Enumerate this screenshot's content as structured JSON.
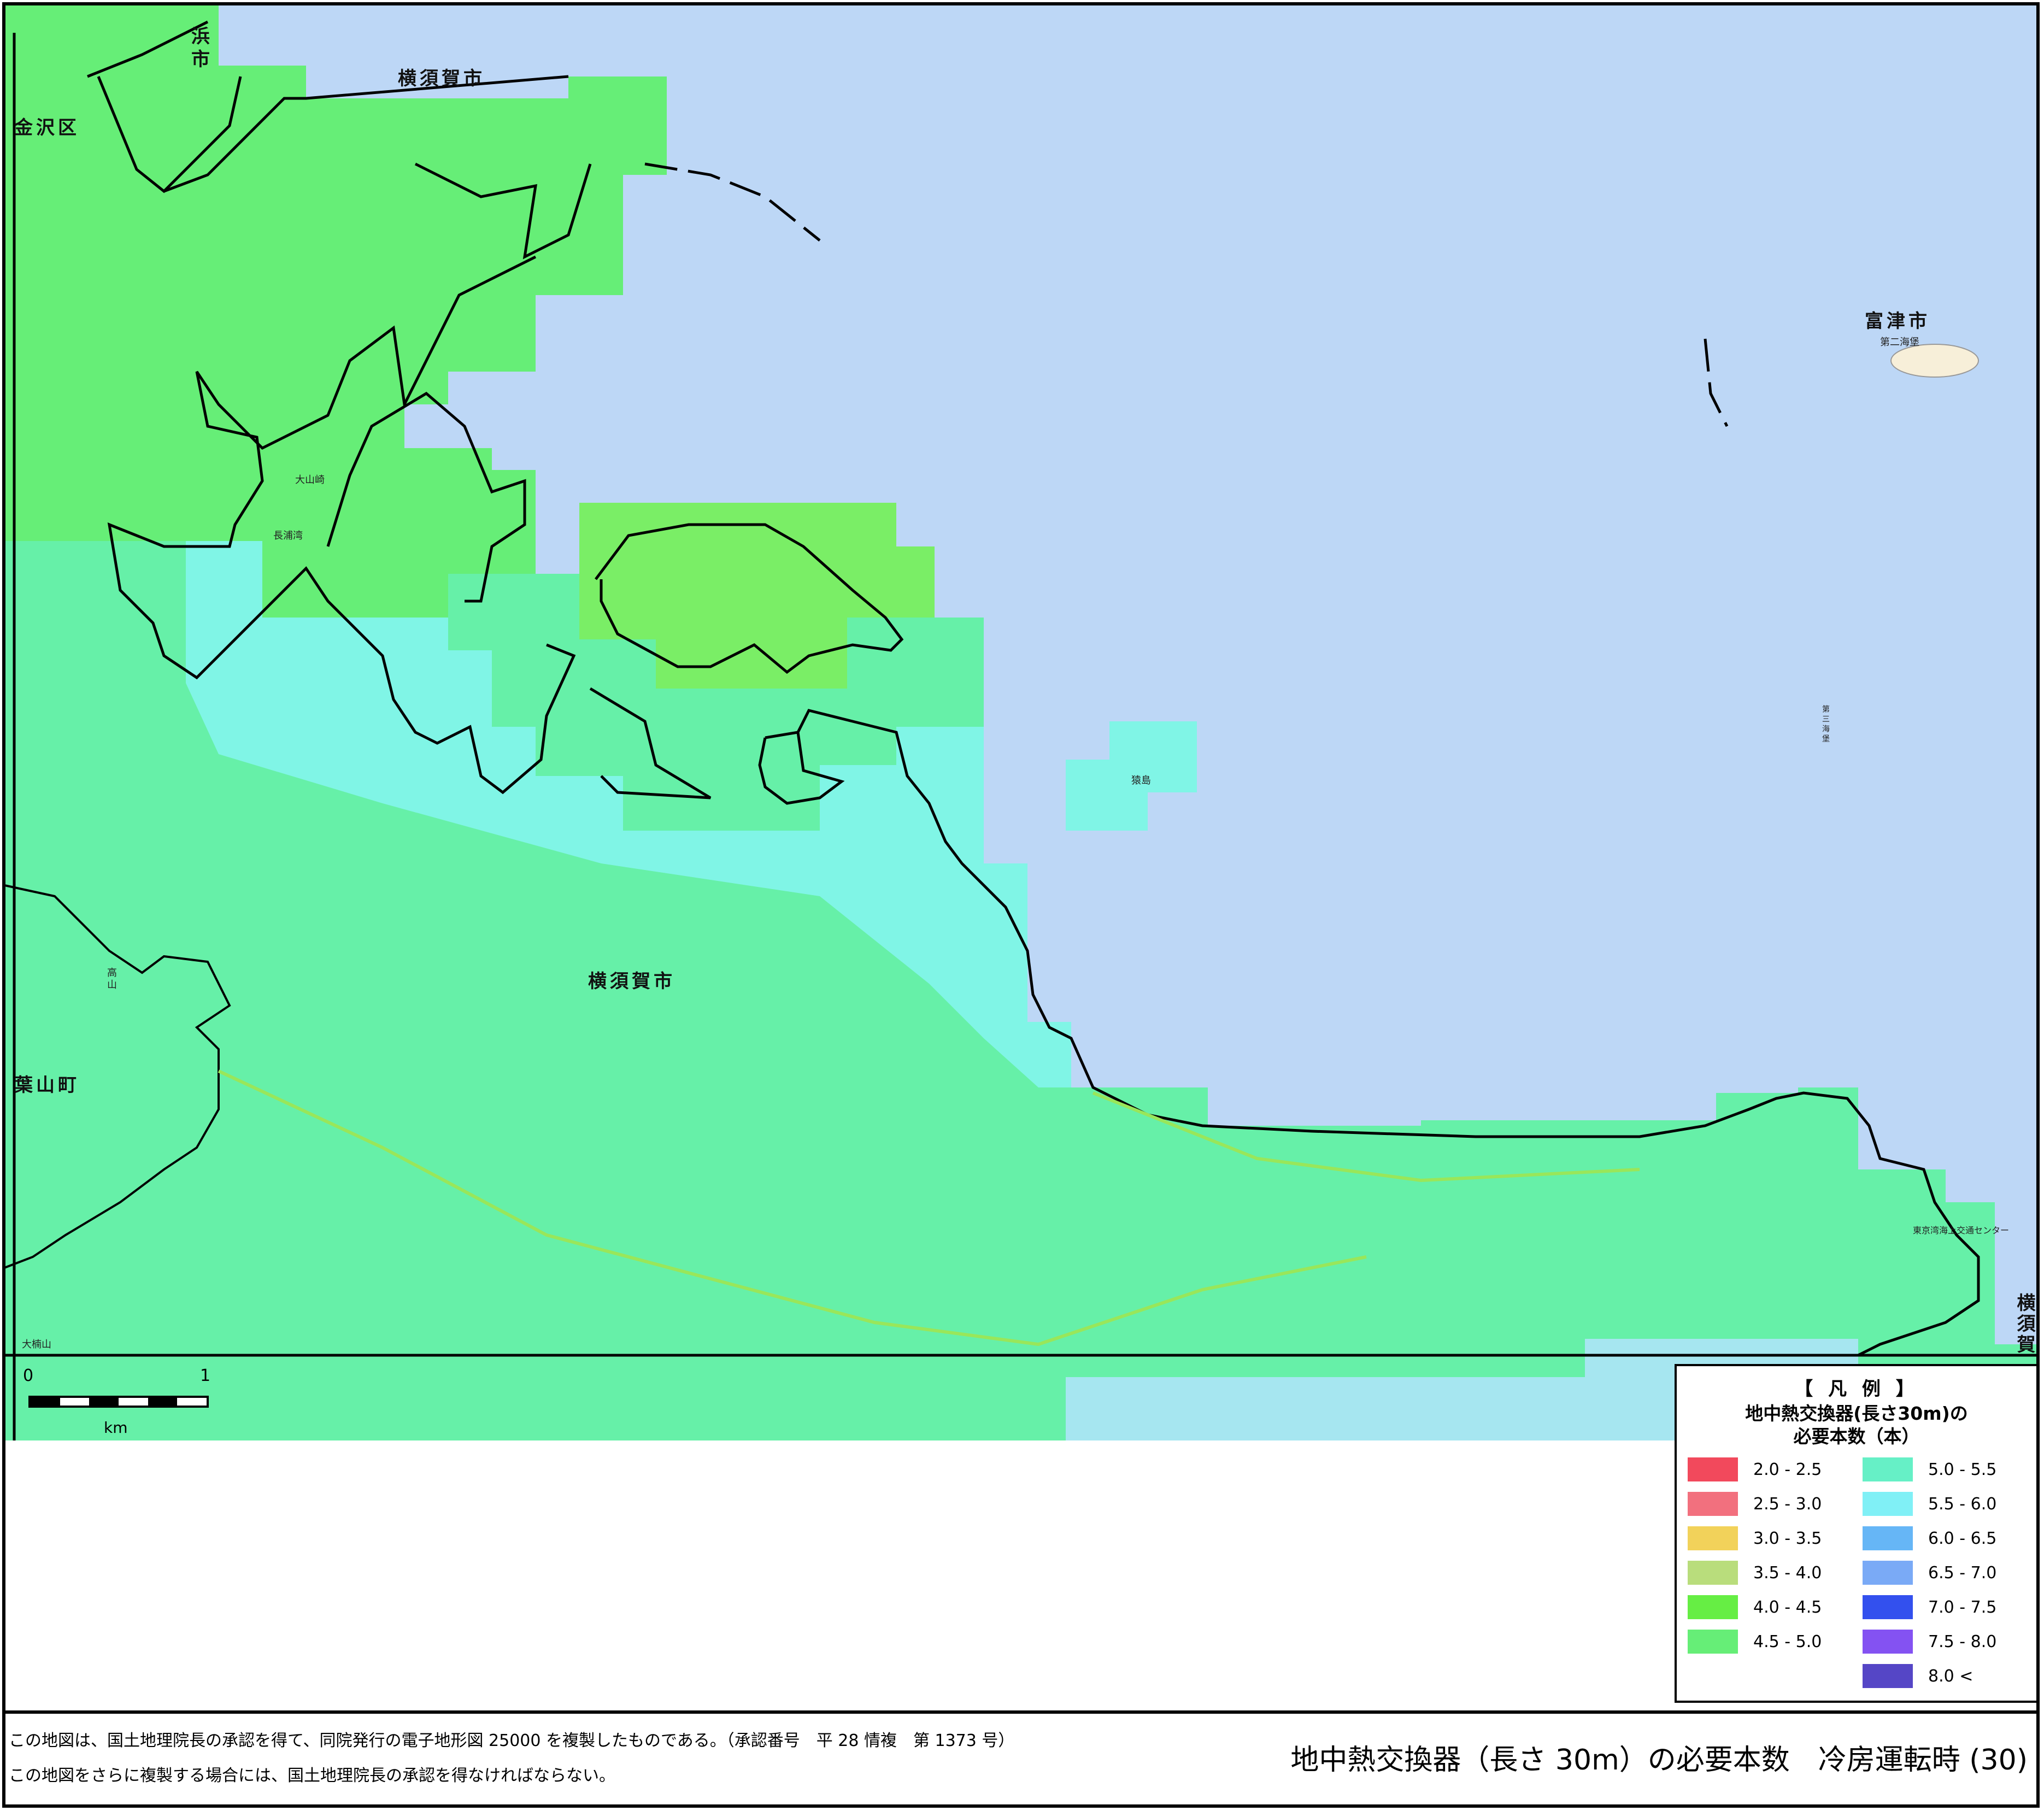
{
  "map": {
    "labels": {
      "yokohama": "浜市",
      "kanazawa": "金沢区",
      "yokosuka_north": "横須賀市",
      "yokosuka_center": "横須賀市",
      "hayama": "葉山町",
      "futtsu": "富津市",
      "yokosuka_east": "横須賀"
    },
    "small_labels": {
      "oyamazaki": "大山崎",
      "nagaura": "長浦湾",
      "otsuyama": "大楠山",
      "sarushima": "猿島",
      "daini_kaiho": "第二海堡",
      "daisan_kaiho": "第三海堡",
      "kaijo": "東京湾海上交通センター",
      "takashi": "高山"
    },
    "colors": {
      "sea": "#bdd7f6",
      "land_green": "#66ee66",
      "land_seafoam": "#66f0a8",
      "land_cyan": "#80f5e6",
      "land_lightblue": "#a6e6f0"
    }
  },
  "scale": {
    "tick_0": "0",
    "tick_1": "1",
    "unit": "km"
  },
  "legend": {
    "title": "【 凡 例 】",
    "subtitle_line1": "地中熱交換器(長さ30m)の",
    "subtitle_line2": "必要本数（本）",
    "items": [
      {
        "label": "2.0 - 2.5",
        "color": "#f2495c"
      },
      {
        "label": "2.5 - 3.0",
        "color": "#f2707e"
      },
      {
        "label": "3.0 - 3.5",
        "color": "#f2d25a"
      },
      {
        "label": "3.5 - 4.0",
        "color": "#b9dd7c"
      },
      {
        "label": "4.0 - 4.5",
        "color": "#66ee44"
      },
      {
        "label": "4.5 - 5.0",
        "color": "#66ee77"
      },
      {
        "label": "5.0 - 5.5",
        "color": "#66f0c6"
      },
      {
        "label": "5.5 - 6.0",
        "color": "#80f0f6"
      },
      {
        "label": "6.0 - 6.5",
        "color": "#66b6f6"
      },
      {
        "label": "6.5 - 7.0",
        "color": "#7aaaf6"
      },
      {
        "label": "7.0 - 7.5",
        "color": "#3350ee"
      },
      {
        "label": "7.5 - 8.0",
        "color": "#8452f2"
      },
      {
        "label": "8.0 <",
        "color": "#5546c6"
      }
    ]
  },
  "footer": {
    "note1": "この地図は、国土地理院長の承認を得て、同院発行の電子地形図 25000 を複製したものである。（承認番号　平 28 情複　第 1373 号）",
    "note2": "この地図をさらに複製する場合には、国土地理院長の承認を得なければならない。",
    "title": "地中熱交換器（長さ 30m）の必要本数　冷房運転時 (30)"
  }
}
